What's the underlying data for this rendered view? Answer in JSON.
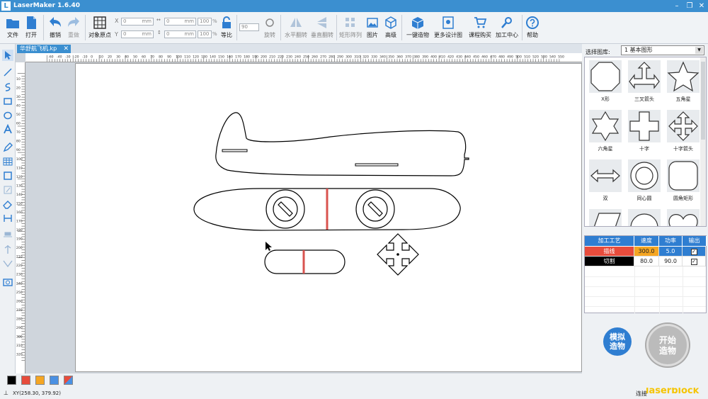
{
  "app": {
    "title": "LaserMaker 1.6.40",
    "logo": "L"
  },
  "window": {
    "min": "–",
    "restore": "❐",
    "close": "✕"
  },
  "toolbar": {
    "file": "文件",
    "open": "打开",
    "undo": "撤销",
    "redo": "重做",
    "origin": "对象原点",
    "x_label": "X",
    "y_label": "Y",
    "x_value": "0",
    "y_value": "0",
    "unit_mm": "mm",
    "w_value": "0",
    "h_value": "0",
    "w_pct": "100",
    "h_pct": "100",
    "pct": "%",
    "lock": "等比",
    "rotate_value": "90",
    "rotate": "旋转",
    "hflip": "水平翻转",
    "vflip": "垂直翻转",
    "array": "矩形阵列",
    "image": "图片",
    "advanced": "高级",
    "oneclick": "一键造物",
    "more_designs": "更多设计图",
    "buy_course": "课程购买",
    "center": "加工中心",
    "help": "帮助"
  },
  "tab": {
    "name": "华舒航飞机.kp",
    "close": "✕"
  },
  "ruler": {
    "top": [
      "-60",
      "-40",
      "-30",
      "-20",
      "-10",
      "0",
      "10",
      "20",
      "30",
      "40",
      "50",
      "60",
      "70",
      "80",
      "90",
      "100",
      "110",
      "120",
      "130",
      "140",
      "150",
      "160",
      "170",
      "180",
      "190",
      "200",
      "210",
      "220",
      "230",
      "240",
      "250",
      "260",
      "270",
      "280",
      "290",
      "300",
      "310",
      "320",
      "330",
      "340",
      "350",
      "360",
      "370",
      "380",
      "390",
      "400",
      "410",
      "420",
      "430",
      "440",
      "450",
      "460",
      "470",
      "480",
      "490",
      "500",
      "510",
      "520",
      "530",
      "540",
      "550"
    ],
    "left": [
      "10",
      "20",
      "30",
      "40",
      "50",
      "60",
      "70",
      "80",
      "90",
      "100",
      "110",
      "120",
      "130",
      "140",
      "150",
      "160",
      "170",
      "180",
      "190",
      "200",
      "210",
      "220",
      "230",
      "240",
      "250",
      "260",
      "270",
      "280",
      "290",
      "300",
      "310",
      "320"
    ]
  },
  "right_panel": {
    "lib_label": "选择图库:",
    "lib_value": "1 基本图形",
    "shapes": [
      {
        "label": "X形",
        "icon": "x-shape-icon"
      },
      {
        "label": "三叉箭头",
        "icon": "three-way-arrow-icon"
      },
      {
        "label": "五角星",
        "icon": "five-star-icon"
      },
      {
        "label": "六角星",
        "icon": "six-star-icon"
      },
      {
        "label": "十字",
        "icon": "cross-icon"
      },
      {
        "label": "十字箭头",
        "icon": "cross-arrow-icon"
      },
      {
        "label": "双",
        "icon": "double-arrow-icon"
      },
      {
        "label": "同心圆",
        "icon": "concentric-circle-icon"
      },
      {
        "label": "圆角矩形",
        "icon": "rounded-rect-icon"
      }
    ],
    "layers": {
      "headers": [
        "加工工艺",
        "速度",
        "功率",
        "输出"
      ],
      "rows": [
        {
          "process": "描线",
          "speed": "300.0",
          "power": "5.0",
          "color": "#e74c3c"
        },
        {
          "process": "切割",
          "speed": "80.0",
          "power": "90.0",
          "color": "#000000"
        }
      ]
    },
    "sim_button": "模拟\n造物",
    "start_button": "开始\n造物"
  },
  "palette": {
    "colors": [
      "#000000",
      "#e74c3c",
      "#f5a623",
      "#4a90e2",
      "#8e44ad"
    ]
  },
  "status": {
    "coords": "XY(258.30, 379.92)",
    "conn": "连接",
    "watermark": "laserblock"
  }
}
